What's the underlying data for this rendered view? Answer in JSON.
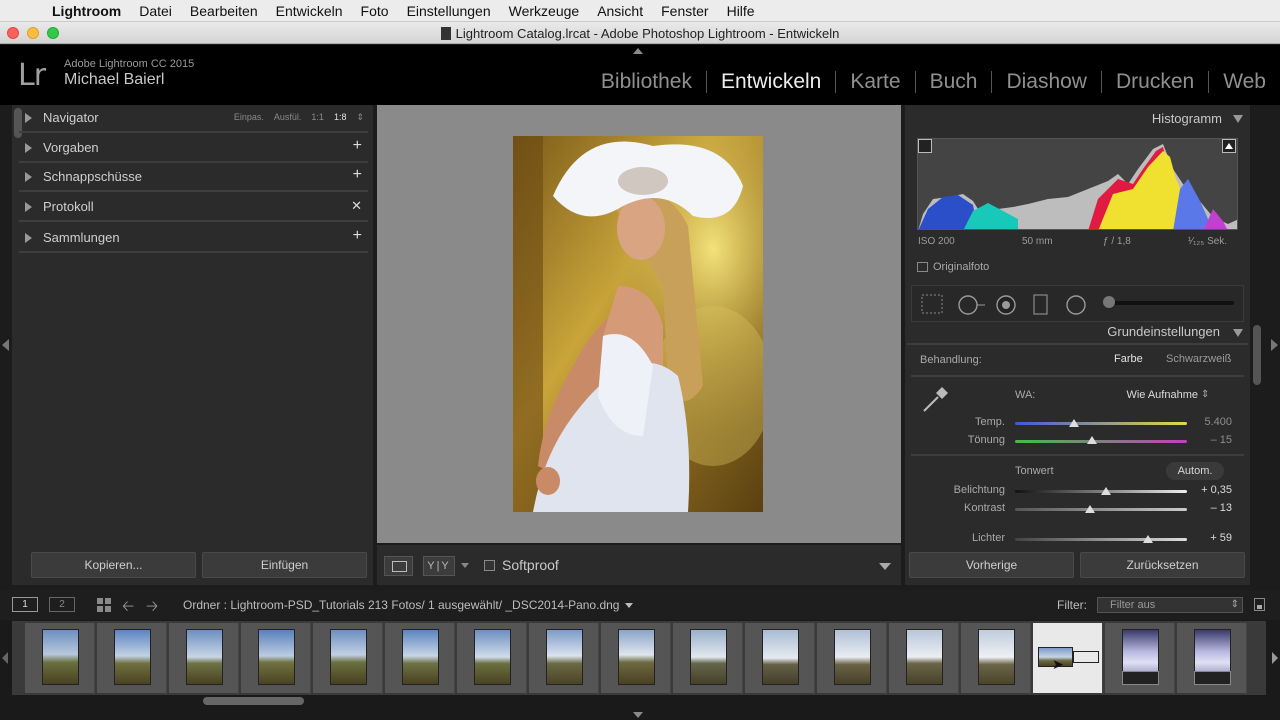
{
  "menubar": {
    "app": "Lightroom",
    "items": [
      "Datei",
      "Bearbeiten",
      "Entwickeln",
      "Foto",
      "Einstellungen",
      "Werkzeuge",
      "Ansicht",
      "Fenster",
      "Hilfe"
    ]
  },
  "window": {
    "title": "Lightroom Catalog.lrcat - Adobe Photoshop Lightroom - Entwickeln"
  },
  "identity": {
    "logo": "Lr",
    "version": "Adobe Lightroom CC 2015",
    "user": "Michael Baierl"
  },
  "modules": [
    "Bibliothek",
    "Entwickeln",
    "Karte",
    "Buch",
    "Diashow",
    "Drucken",
    "Web"
  ],
  "active_module": "Entwickeln",
  "left_panel": {
    "navigator": {
      "label": "Navigator",
      "opts": [
        "Einpas.",
        "Ausfül.",
        "1:1",
        "1:8"
      ],
      "selected": "1:8"
    },
    "sections": [
      {
        "label": "Vorgaben",
        "ctl": "+"
      },
      {
        "label": "Schnappschüsse",
        "ctl": "+"
      },
      {
        "label": "Protokoll",
        "ctl": "✕"
      },
      {
        "label": "Sammlungen",
        "ctl": "+"
      }
    ],
    "copy_button": "Kopieren...",
    "paste_button": "Einfügen"
  },
  "toolbar": {
    "yy_label": "Y|Y",
    "softproof": "Softproof"
  },
  "right_panel": {
    "histogram_title": "Histogramm",
    "exif": {
      "iso": "ISO 200",
      "focal": "50 mm",
      "aperture": "ƒ / 1,8",
      "shutter": "¹⁄₁₂₅ Sek."
    },
    "original_label": "Originalfoto",
    "basic_title": "Grundeinstellungen",
    "treatment_label": "Behandlung:",
    "treatment_color": "Farbe",
    "treatment_bw": "Schwarzweiß",
    "wb_label": "WA:",
    "wb_value": "Wie Aufnahme",
    "temp": {
      "label": "Temp.",
      "value": "5.400"
    },
    "tint": {
      "label": "Tönung",
      "value": "– 15"
    },
    "tone_label": "Tonwert",
    "auto_button": "Autom.",
    "exposure": {
      "label": "Belichtung",
      "value": "+ 0,35"
    },
    "contrast": {
      "label": "Kontrast",
      "value": "– 13"
    },
    "highlights": {
      "label": "Lichter",
      "value": "+ 59"
    },
    "prev_button": "Vorherige",
    "reset_button": "Zurücksetzen"
  },
  "filmstrip_header": {
    "monitor1": "1",
    "monitor2": "2",
    "path": "Ordner : Lightroom-PSD_Tutorials   213 Fotos/  1 ausgewählt/  _DSC2014-Pano.dng",
    "filter_label": "Filter:",
    "filter_value": "Filter aus"
  },
  "colors": {
    "accent_active": "#ececec",
    "panel": "#2b2b2b",
    "center": "#8a8a8a"
  }
}
